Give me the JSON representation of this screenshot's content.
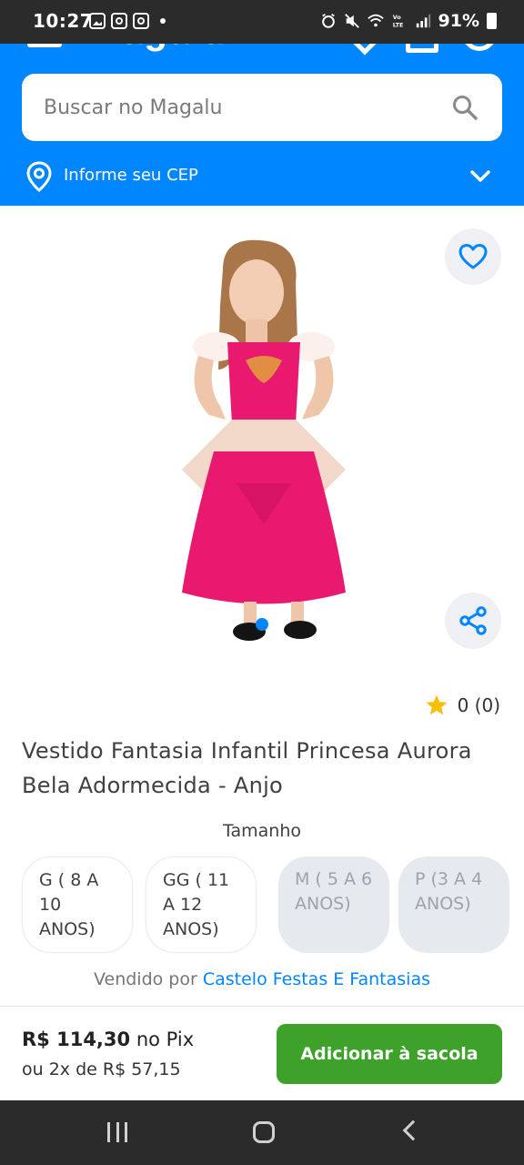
{
  "status_bar": {
    "time": "10:27",
    "battery": "91%"
  },
  "header": {
    "logo": "Magalu"
  },
  "search": {
    "placeholder": "Buscar no Magalu"
  },
  "cep": {
    "label": "Informe seu CEP"
  },
  "product": {
    "rating_text": "0 (0)",
    "title": "Vestido Fantasia Infantil Princesa Aurora Bela Adormecida - Anjo",
    "size_label": "Tamanho",
    "sizes": [
      {
        "label": "G ( 8 A 10 ANOS)",
        "available": true
      },
      {
        "label": "GG ( 11 A 12 ANOS)",
        "available": true
      },
      {
        "label": "M ( 5 A 6 ANOS)",
        "available": false
      },
      {
        "label": "P (3 A 4 ANOS)",
        "available": false
      }
    ],
    "seller_prefix": "Vendido por",
    "seller_name": "Castelo Festas E Fantasias"
  },
  "buy_bar": {
    "price": "R$ 114,30",
    "price_suffix": "no Pix",
    "installments": "ou 2x de R$ 57,15",
    "add_button": "Adicionar à sacola"
  },
  "colors": {
    "brand_blue": "#0086ff",
    "buy_green": "#3ea22a",
    "dress_pink": "#e8196e"
  }
}
